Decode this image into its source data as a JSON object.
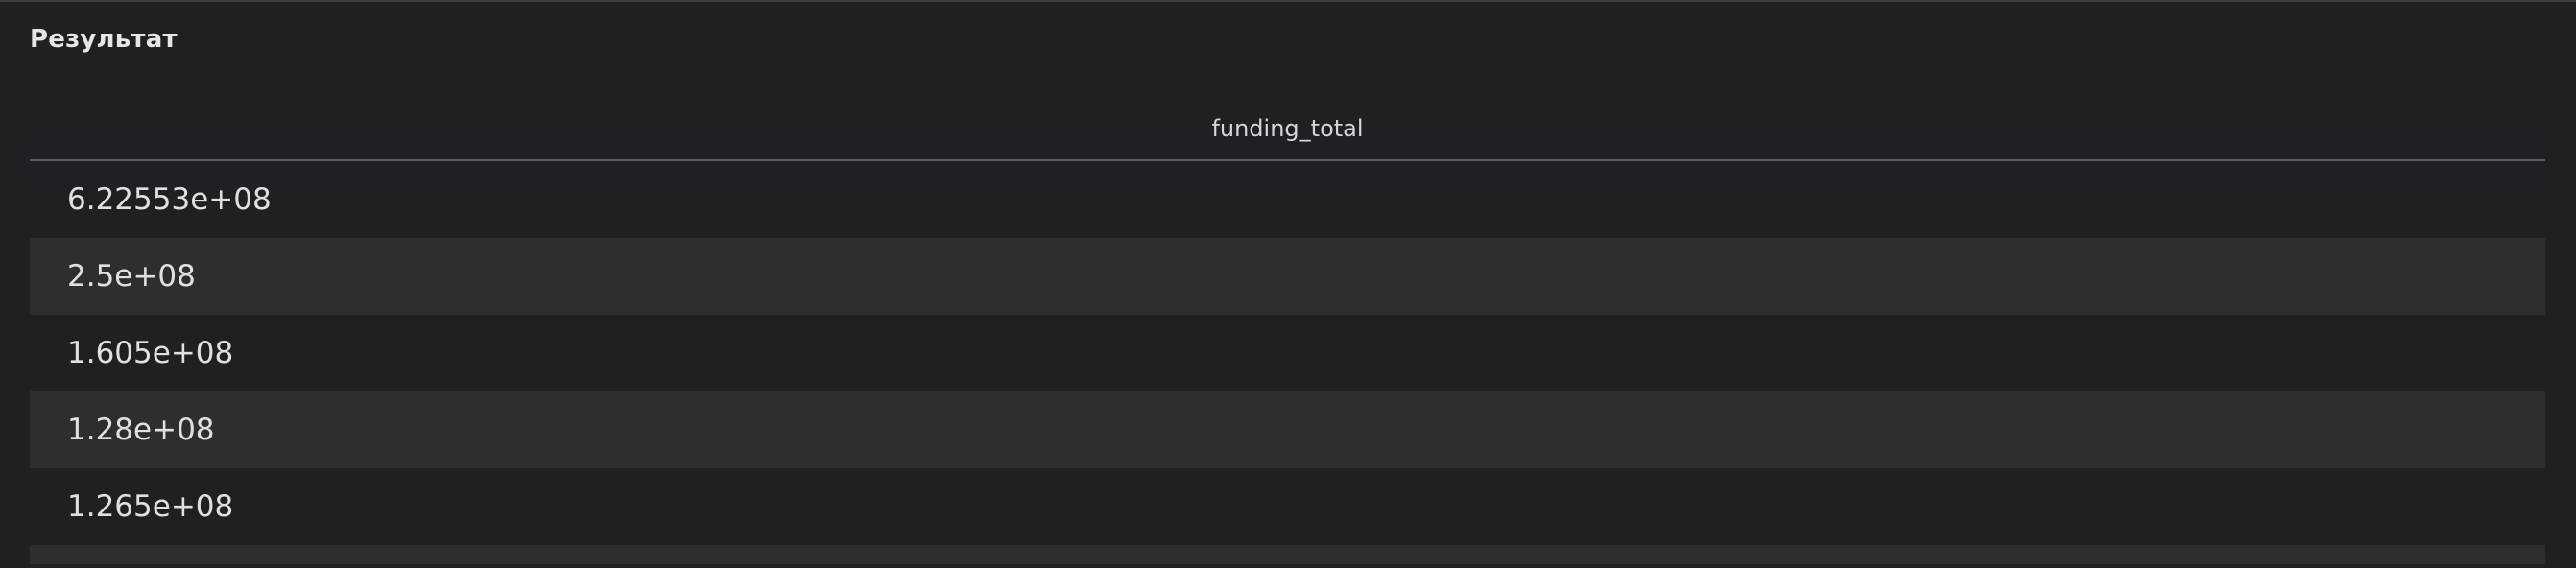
{
  "panel": {
    "title": "Результат"
  },
  "table": {
    "columns": [
      "funding_total"
    ],
    "rows": [
      [
        "6.22553e+08"
      ],
      [
        "2.5e+08"
      ],
      [
        "1.605e+08"
      ],
      [
        "1.28e+08"
      ],
      [
        "1.265e+08"
      ]
    ]
  }
}
